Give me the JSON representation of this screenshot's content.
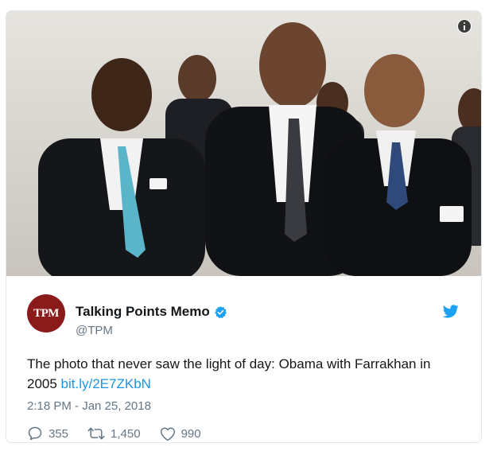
{
  "tweet": {
    "account_name": "Talking Points Memo",
    "handle": "@TPM",
    "avatar_text": "TPM",
    "text": "The photo that never saw the light of day: Obama with Farrakhan in 2005 ",
    "link_text": "bit.ly/2E7ZKbN",
    "timestamp": "2:18 PM - Jan 25, 2018",
    "replies": "355",
    "retweets": "1,450",
    "likes": "990"
  },
  "icons": {
    "info": "info-icon",
    "verified": "verified-badge-icon",
    "twitter": "twitter-bird-icon",
    "reply": "reply-bubble-icon",
    "retweet": "retweet-arrows-icon",
    "like": "heart-icon"
  },
  "colors": {
    "avatar_bg": "#8b1b1b",
    "link": "#1b95e0",
    "muted": "#657786",
    "verified": "#1da1f2"
  }
}
